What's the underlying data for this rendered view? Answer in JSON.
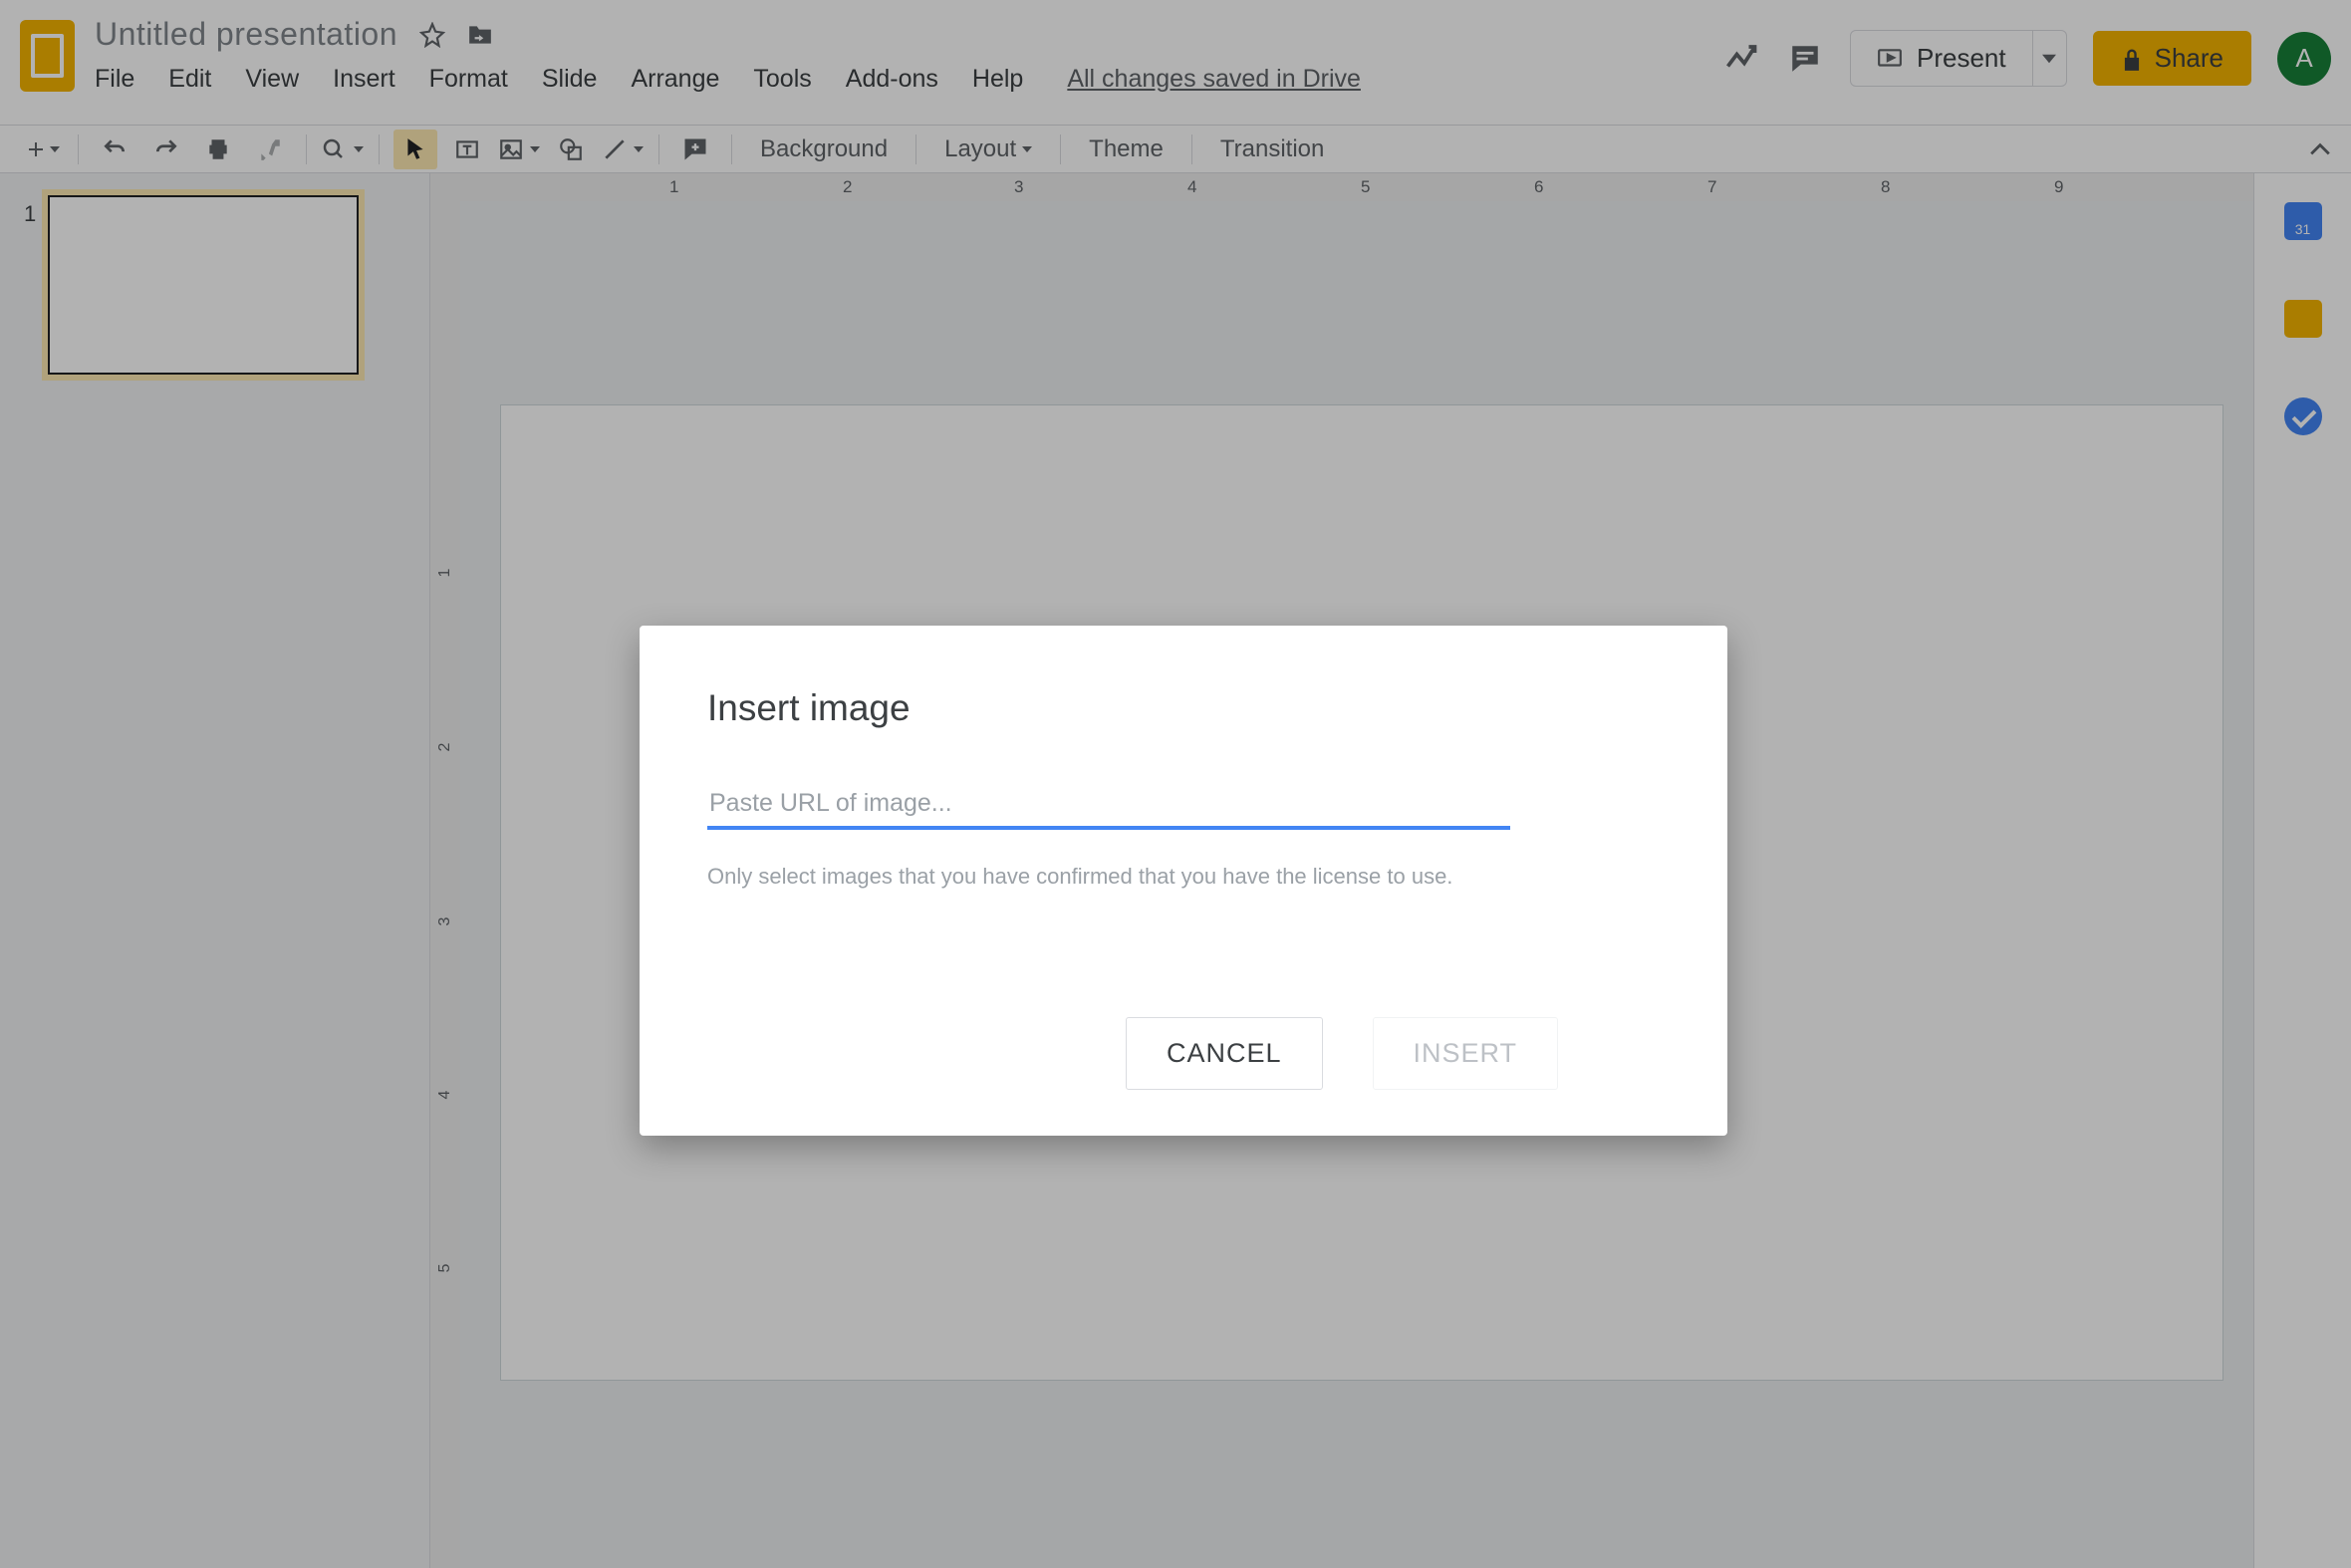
{
  "header": {
    "title": "Untitled presentation",
    "saved_text": "All changes saved in Drive",
    "present_label": "Present",
    "share_label": "Share",
    "avatar_initial": "A"
  },
  "menubar": {
    "file": "File",
    "edit": "Edit",
    "view": "View",
    "insert": "Insert",
    "format": "Format",
    "slide": "Slide",
    "arrange": "Arrange",
    "tools": "Tools",
    "addons": "Add-ons",
    "help": "Help"
  },
  "toolbar": {
    "background": "Background",
    "layout": "Layout",
    "theme": "Theme",
    "transition": "Transition"
  },
  "thumbs": {
    "slide1_num": "1"
  },
  "hruler": {
    "t1": "1",
    "t2": "2",
    "t3": "3",
    "t4": "4",
    "t5": "5",
    "t6": "6",
    "t7": "7",
    "t8": "8",
    "t9": "9"
  },
  "vruler": {
    "t1": "1",
    "t2": "2",
    "t3": "3",
    "t4": "4",
    "t5": "5"
  },
  "sidepanel": {
    "cal_day": "31"
  },
  "dialog": {
    "title": "Insert image",
    "placeholder": "Paste URL of image...",
    "value": "",
    "hint": "Only select images that you have confirmed that you have the license to use.",
    "cancel": "CANCEL",
    "insert": "INSERT"
  }
}
